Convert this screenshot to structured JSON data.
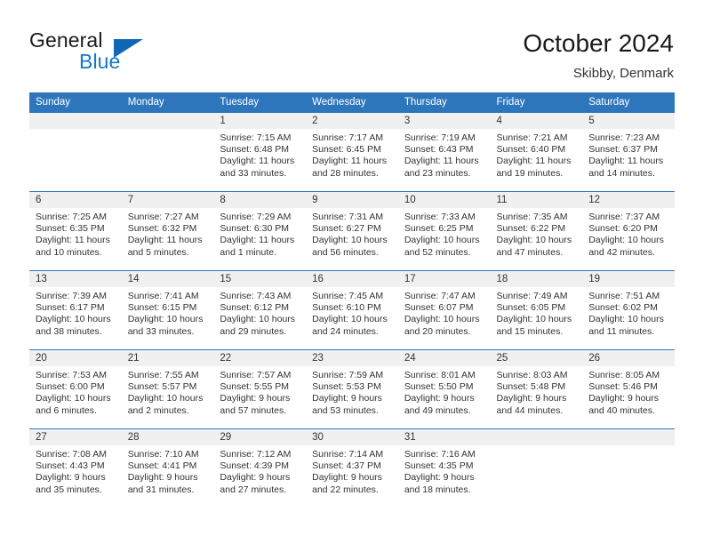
{
  "brand": {
    "name_part1": "General",
    "name_part2": "Blue",
    "logo_icon": "triangle-logo-icon"
  },
  "header": {
    "title": "October 2024",
    "subtitle": "Skibby, Denmark"
  },
  "colors": {
    "header_blue": "#2e76bc",
    "brand_blue": "#1477c9",
    "daynum_band": "#f0f0f0",
    "text": "#333333"
  },
  "calendar": {
    "weekday_headers": [
      "Sunday",
      "Monday",
      "Tuesday",
      "Wednesday",
      "Thursday",
      "Friday",
      "Saturday"
    ],
    "weeks": [
      [
        {
          "day": "",
          "empty": true
        },
        {
          "day": "",
          "empty": true
        },
        {
          "day": "1",
          "sunrise": "Sunrise: 7:15 AM",
          "sunset": "Sunset: 6:48 PM",
          "daylight": "Daylight: 11 hours and 33 minutes."
        },
        {
          "day": "2",
          "sunrise": "Sunrise: 7:17 AM",
          "sunset": "Sunset: 6:45 PM",
          "daylight": "Daylight: 11 hours and 28 minutes."
        },
        {
          "day": "3",
          "sunrise": "Sunrise: 7:19 AM",
          "sunset": "Sunset: 6:43 PM",
          "daylight": "Daylight: 11 hours and 23 minutes."
        },
        {
          "day": "4",
          "sunrise": "Sunrise: 7:21 AM",
          "sunset": "Sunset: 6:40 PM",
          "daylight": "Daylight: 11 hours and 19 minutes."
        },
        {
          "day": "5",
          "sunrise": "Sunrise: 7:23 AM",
          "sunset": "Sunset: 6:37 PM",
          "daylight": "Daylight: 11 hours and 14 minutes."
        }
      ],
      [
        {
          "day": "6",
          "sunrise": "Sunrise: 7:25 AM",
          "sunset": "Sunset: 6:35 PM",
          "daylight": "Daylight: 11 hours and 10 minutes."
        },
        {
          "day": "7",
          "sunrise": "Sunrise: 7:27 AM",
          "sunset": "Sunset: 6:32 PM",
          "daylight": "Daylight: 11 hours and 5 minutes."
        },
        {
          "day": "8",
          "sunrise": "Sunrise: 7:29 AM",
          "sunset": "Sunset: 6:30 PM",
          "daylight": "Daylight: 11 hours and 1 minute."
        },
        {
          "day": "9",
          "sunrise": "Sunrise: 7:31 AM",
          "sunset": "Sunset: 6:27 PM",
          "daylight": "Daylight: 10 hours and 56 minutes."
        },
        {
          "day": "10",
          "sunrise": "Sunrise: 7:33 AM",
          "sunset": "Sunset: 6:25 PM",
          "daylight": "Daylight: 10 hours and 52 minutes."
        },
        {
          "day": "11",
          "sunrise": "Sunrise: 7:35 AM",
          "sunset": "Sunset: 6:22 PM",
          "daylight": "Daylight: 10 hours and 47 minutes."
        },
        {
          "day": "12",
          "sunrise": "Sunrise: 7:37 AM",
          "sunset": "Sunset: 6:20 PM",
          "daylight": "Daylight: 10 hours and 42 minutes."
        }
      ],
      [
        {
          "day": "13",
          "sunrise": "Sunrise: 7:39 AM",
          "sunset": "Sunset: 6:17 PM",
          "daylight": "Daylight: 10 hours and 38 minutes."
        },
        {
          "day": "14",
          "sunrise": "Sunrise: 7:41 AM",
          "sunset": "Sunset: 6:15 PM",
          "daylight": "Daylight: 10 hours and 33 minutes."
        },
        {
          "day": "15",
          "sunrise": "Sunrise: 7:43 AM",
          "sunset": "Sunset: 6:12 PM",
          "daylight": "Daylight: 10 hours and 29 minutes."
        },
        {
          "day": "16",
          "sunrise": "Sunrise: 7:45 AM",
          "sunset": "Sunset: 6:10 PM",
          "daylight": "Daylight: 10 hours and 24 minutes."
        },
        {
          "day": "17",
          "sunrise": "Sunrise: 7:47 AM",
          "sunset": "Sunset: 6:07 PM",
          "daylight": "Daylight: 10 hours and 20 minutes."
        },
        {
          "day": "18",
          "sunrise": "Sunrise: 7:49 AM",
          "sunset": "Sunset: 6:05 PM",
          "daylight": "Daylight: 10 hours and 15 minutes."
        },
        {
          "day": "19",
          "sunrise": "Sunrise: 7:51 AM",
          "sunset": "Sunset: 6:02 PM",
          "daylight": "Daylight: 10 hours and 11 minutes."
        }
      ],
      [
        {
          "day": "20",
          "sunrise": "Sunrise: 7:53 AM",
          "sunset": "Sunset: 6:00 PM",
          "daylight": "Daylight: 10 hours and 6 minutes."
        },
        {
          "day": "21",
          "sunrise": "Sunrise: 7:55 AM",
          "sunset": "Sunset: 5:57 PM",
          "daylight": "Daylight: 10 hours and 2 minutes."
        },
        {
          "day": "22",
          "sunrise": "Sunrise: 7:57 AM",
          "sunset": "Sunset: 5:55 PM",
          "daylight": "Daylight: 9 hours and 57 minutes."
        },
        {
          "day": "23",
          "sunrise": "Sunrise: 7:59 AM",
          "sunset": "Sunset: 5:53 PM",
          "daylight": "Daylight: 9 hours and 53 minutes."
        },
        {
          "day": "24",
          "sunrise": "Sunrise: 8:01 AM",
          "sunset": "Sunset: 5:50 PM",
          "daylight": "Daylight: 9 hours and 49 minutes."
        },
        {
          "day": "25",
          "sunrise": "Sunrise: 8:03 AM",
          "sunset": "Sunset: 5:48 PM",
          "daylight": "Daylight: 9 hours and 44 minutes."
        },
        {
          "day": "26",
          "sunrise": "Sunrise: 8:05 AM",
          "sunset": "Sunset: 5:46 PM",
          "daylight": "Daylight: 9 hours and 40 minutes."
        }
      ],
      [
        {
          "day": "27",
          "sunrise": "Sunrise: 7:08 AM",
          "sunset": "Sunset: 4:43 PM",
          "daylight": "Daylight: 9 hours and 35 minutes."
        },
        {
          "day": "28",
          "sunrise": "Sunrise: 7:10 AM",
          "sunset": "Sunset: 4:41 PM",
          "daylight": "Daylight: 9 hours and 31 minutes."
        },
        {
          "day": "29",
          "sunrise": "Sunrise: 7:12 AM",
          "sunset": "Sunset: 4:39 PM",
          "daylight": "Daylight: 9 hours and 27 minutes."
        },
        {
          "day": "30",
          "sunrise": "Sunrise: 7:14 AM",
          "sunset": "Sunset: 4:37 PM",
          "daylight": "Daylight: 9 hours and 22 minutes."
        },
        {
          "day": "31",
          "sunrise": "Sunrise: 7:16 AM",
          "sunset": "Sunset: 4:35 PM",
          "daylight": "Daylight: 9 hours and 18 minutes."
        },
        {
          "day": "",
          "empty": true
        },
        {
          "day": "",
          "empty": true
        }
      ]
    ]
  }
}
